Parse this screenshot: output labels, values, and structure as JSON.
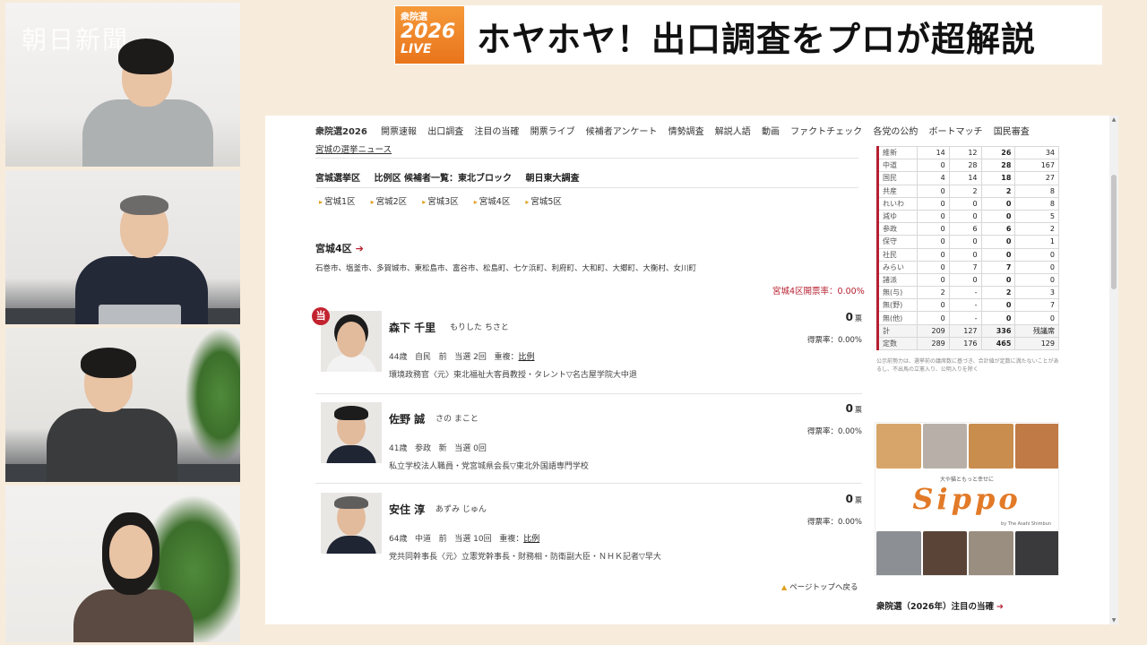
{
  "watermark": "朝日新聞",
  "banner": {
    "badge_top": "衆院選",
    "badge_year": "2026",
    "badge_bottom": "LIVE",
    "title": "ホヤホヤ！出口調査をプロが超解説"
  },
  "nav": {
    "brand": "衆院選2026",
    "items": [
      "開票速報",
      "出口調査",
      "注目の当確",
      "開票ライブ",
      "候補者アンケート",
      "情勢調査",
      "解説人語",
      "動画",
      "ファクトチェック",
      "各党の公約",
      "ボートマッチ",
      "国民審査"
    ]
  },
  "sublink": "宮城の選挙ニュース",
  "section_nav": [
    "宮城選挙区",
    "比例区 候補者一覧：東北ブロック",
    "朝日東大調査"
  ],
  "districts": [
    "宮城1区",
    "宮城2区",
    "宮城3区",
    "宮城4区",
    "宮城5区"
  ],
  "district": {
    "title": "宮城4区",
    "cities": "石巻市、塩釜市、多賀城市、東松島市、富谷市、松島町、七ケ浜町、利府町、大和町、大郷町、大衡村、女川町",
    "counted": "宮城4区開票率：0.00%"
  },
  "candidates": [
    {
      "win": "当",
      "name": "森下 千里",
      "kana": "もりした ちさと",
      "age": "44歳",
      "party": "自民",
      "status": "前",
      "elected": "当選 2回",
      "dual_label": "重複：",
      "dual": "比例",
      "career": "環境政務官〈元〉東北福祉大客員教授・タレント▽名古屋学院大中退",
      "votes": "0",
      "votes_unit": "票",
      "rate": "得票率：0.00%"
    },
    {
      "win": "",
      "name": "佐野 誠",
      "kana": "さの まこと",
      "age": "41歳",
      "party": "参政",
      "status": "新",
      "elected": "当選 0回",
      "dual_label": "",
      "dual": "",
      "career": "私立学校法人職員・党宮城県会長▽東北外国語専門学校",
      "votes": "0",
      "votes_unit": "票",
      "rate": "得票率：0.00%"
    },
    {
      "win": "",
      "name": "安住 淳",
      "kana": "あずみ じゅん",
      "age": "64歳",
      "party": "中道",
      "status": "前",
      "elected": "当選 10回",
      "dual_label": "重複：",
      "dual": "比例",
      "career": "党共同幹事長〈元〉立憲党幹事長・財務相・防衛副大臣・ＮＨＫ記者▽早大",
      "votes": "0",
      "votes_unit": "票",
      "rate": "得票率：0.00%"
    }
  ],
  "page_top": "ページトップへ戻る",
  "seats": {
    "rows": [
      {
        "party": "維新",
        "v": [
          "14",
          "12",
          "26",
          "34"
        ]
      },
      {
        "party": "中道",
        "v": [
          "0",
          "28",
          "28",
          "167"
        ]
      },
      {
        "party": "国民",
        "v": [
          "4",
          "14",
          "18",
          "27"
        ]
      },
      {
        "party": "共産",
        "v": [
          "0",
          "2",
          "2",
          "8"
        ]
      },
      {
        "party": "れいわ",
        "v": [
          "0",
          "0",
          "0",
          "8"
        ]
      },
      {
        "party": "減ゆ",
        "v": [
          "0",
          "0",
          "0",
          "5"
        ]
      },
      {
        "party": "参政",
        "v": [
          "0",
          "6",
          "6",
          "2"
        ]
      },
      {
        "party": "保守",
        "v": [
          "0",
          "0",
          "0",
          "1"
        ]
      },
      {
        "party": "社民",
        "v": [
          "0",
          "0",
          "0",
          "0"
        ]
      },
      {
        "party": "みらい",
        "v": [
          "0",
          "7",
          "7",
          "0"
        ]
      },
      {
        "party": "諸派",
        "v": [
          "0",
          "0",
          "0",
          "0"
        ]
      },
      {
        "party": "無(与)",
        "v": [
          "2",
          "-",
          "2",
          "3"
        ]
      },
      {
        "party": "無(野)",
        "v": [
          "0",
          "-",
          "0",
          "7"
        ]
      },
      {
        "party": "無(他)",
        "v": [
          "0",
          "-",
          "0",
          "0"
        ]
      }
    ],
    "total_label": "計",
    "total": [
      "209",
      "127",
      "336",
      "残議席"
    ],
    "quota_label": "定数",
    "quota": [
      "289",
      "176",
      "465",
      "129"
    ]
  },
  "seat_note": "公示前勢力は、選挙前の議席数に基づき、合計値が定数に満たないことがあるし、不出馬の立憲入り、公明入りを除く",
  "ad": {
    "sub": "大や猫ともっと幸せに",
    "logo": "Sippo",
    "small": "by The Asahi Shimbun"
  },
  "attention": "衆院選（2026年）注目の当確",
  "colors": {
    "accent": "#b52030",
    "badge": "#ee8226",
    "background": "#f7ecdc"
  }
}
